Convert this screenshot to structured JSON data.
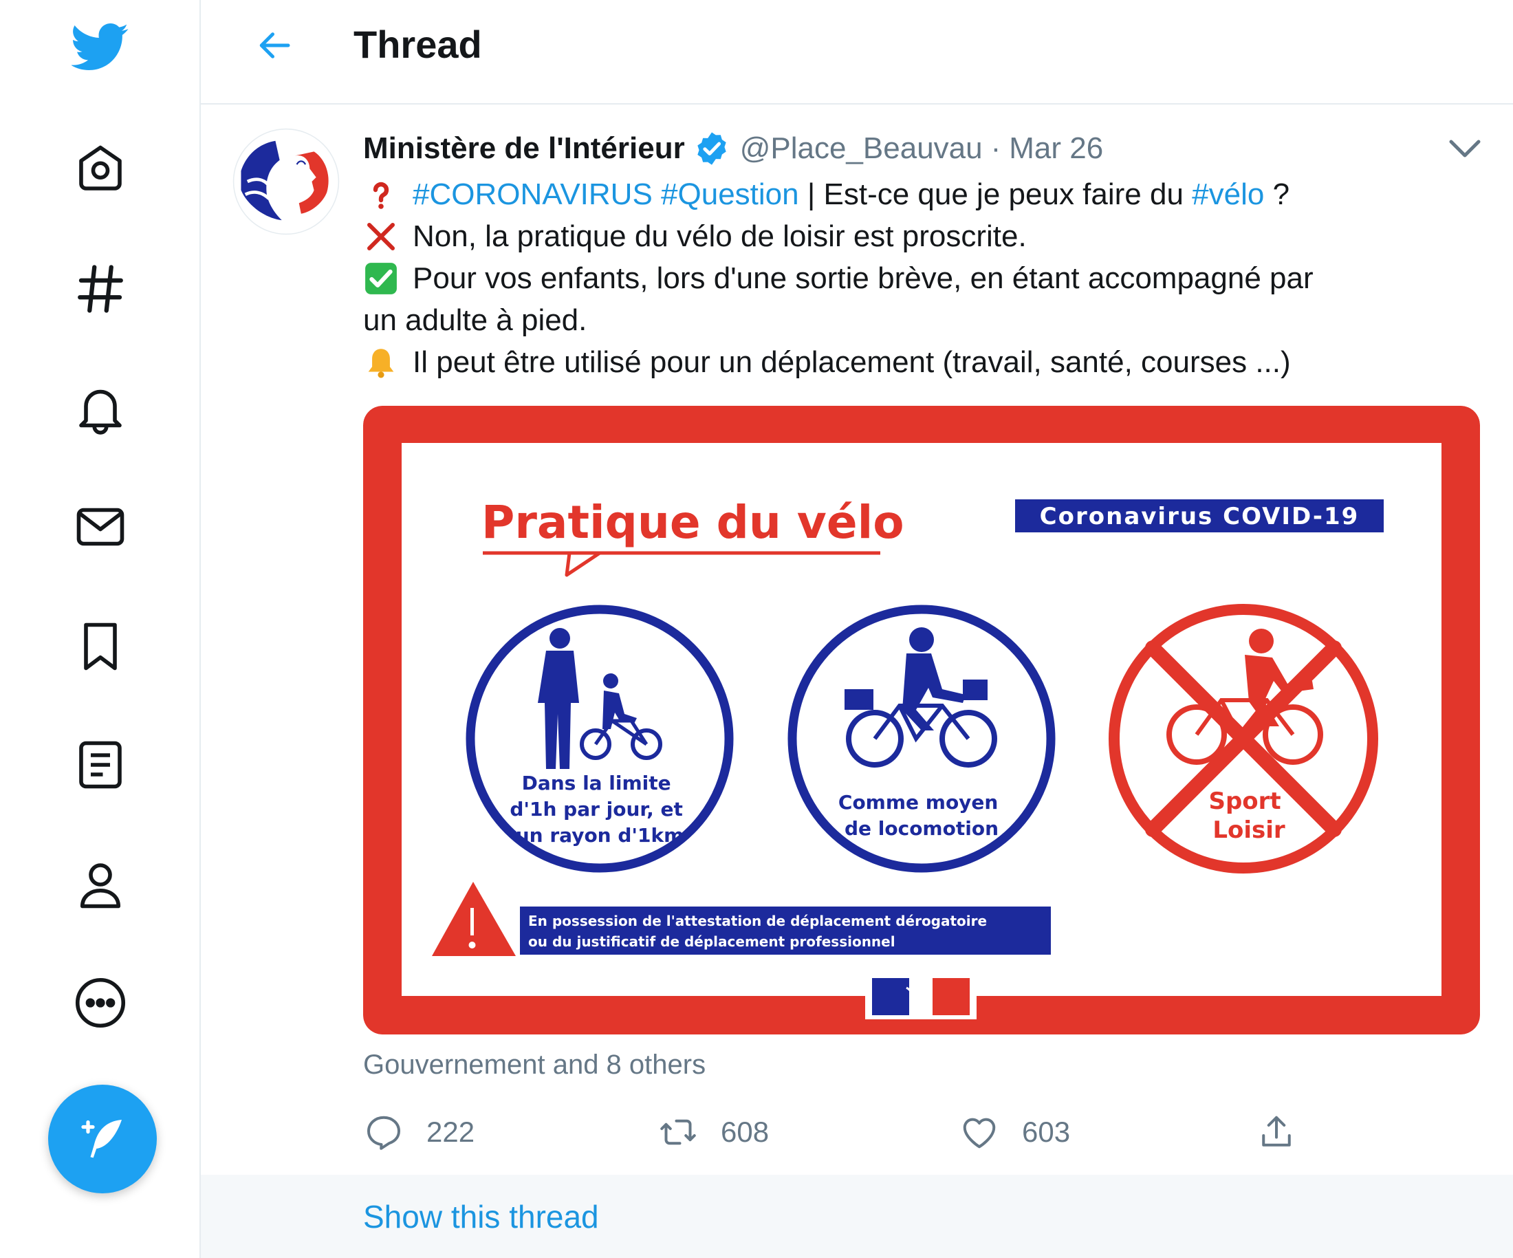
{
  "header": {
    "title": "Thread"
  },
  "nav": {
    "icons": [
      "twitter-logo-icon",
      "home-icon",
      "hashtag-icon",
      "bell-icon",
      "mail-icon",
      "bookmark-icon",
      "list-icon",
      "profile-icon",
      "more-icon",
      "compose-icon"
    ]
  },
  "tweet": {
    "author": "Ministère de l'Intérieur",
    "handle": "@Place_Beauvau",
    "separator": "·",
    "date": "Mar 26",
    "line1": {
      "tag1": "#CORONAVIRUS",
      "tag2": "#Question",
      "text": " | Est-ce que je peux faire du ",
      "tag3": "#vélo",
      "end": " ?"
    },
    "line2": "Non, la pratique du vélo de loisir est proscrite.",
    "line3": "Pour vos enfants, lors d'une sortie brève, en étant accompagné par",
    "line4": "un adulte à pied.",
    "line5": "Il peut être utilisé pour un déplacement (travail, santé, courses ...)",
    "social_context": "Gouvernement and 8 others",
    "actions": {
      "replies": "222",
      "retweets": "608",
      "likes": "603"
    },
    "show_thread": "Show this thread"
  },
  "poster": {
    "title": "Pratique du vélo",
    "badge": "Coronavirus COVID-19",
    "circle1": [
      "Dans la limite",
      "d'1h par jour, et",
      "un rayon d'1km"
    ],
    "circle2": [
      "Comme moyen",
      "de locomotion"
    ],
    "circle3": [
      "Sport",
      "Loisir"
    ],
    "warning": [
      "En possession de l'attestation de déplacement dérogatoire",
      "ou du justificatif de déplacement professionnel"
    ]
  },
  "colors": {
    "twitter_blue": "#1da1f2",
    "link_blue": "#1b95e0",
    "muted_gray": "#657786",
    "poster_red": "#e2362b",
    "poster_navy": "#1c2a9c"
  }
}
